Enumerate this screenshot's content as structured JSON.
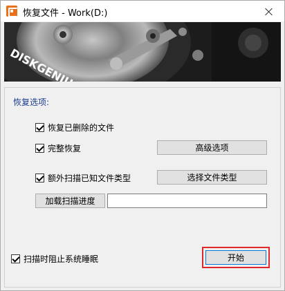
{
  "window": {
    "title": "恢复文件 - Work(D:)"
  },
  "banner": {
    "brand_text": "DISKGENIUS"
  },
  "options": {
    "section_label": "恢复选项:",
    "recover_deleted": {
      "label": "恢复已删除的文件",
      "checked": true
    },
    "full_recovery": {
      "label": "完整恢复",
      "checked": true
    },
    "advanced_button": "高级选项",
    "scan_known_types": {
      "label": "额外扫描已知文件类型",
      "checked": true
    },
    "select_types_button": "选择文件类型",
    "load_progress_button": "加载扫描进度",
    "progress_path_value": "",
    "prevent_sleep": {
      "label": "扫描时阻止系统睡眠",
      "checked": true
    },
    "start_button": "开始"
  },
  "colors": {
    "section_label": "#1b3d8f",
    "highlight_border": "#e0262b",
    "focus_border": "#0078d7",
    "app_icon": "#e8711c"
  },
  "icons": {
    "app": "diskgenius-app-icon",
    "close": "close-icon"
  }
}
